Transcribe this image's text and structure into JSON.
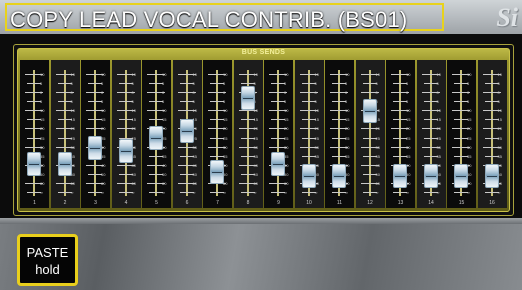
{
  "title": "COPY LEAD VOCAL CONTRIB. (BS01)",
  "logo": "Si",
  "bus_sends_label": "BUS SENDS",
  "scale_labels": [
    "10",
    "5",
    "0",
    "5",
    "10",
    "15",
    "20",
    "25",
    "30",
    "35",
    "40",
    "50",
    "60",
    "∞"
  ],
  "channels": [
    {
      "label": "1",
      "level": 0.2
    },
    {
      "label": "2",
      "level": 0.2
    },
    {
      "label": "3",
      "level": 0.35
    },
    {
      "label": "4",
      "level": 0.32
    },
    {
      "label": "5",
      "level": 0.45
    },
    {
      "label": "6",
      "level": 0.52
    },
    {
      "label": "7",
      "level": 0.12
    },
    {
      "label": "8",
      "level": 0.84
    },
    {
      "label": "9",
      "level": 0.2
    },
    {
      "label": "10",
      "level": 0.08
    },
    {
      "label": "11",
      "level": 0.08
    },
    {
      "label": "12",
      "level": 0.72
    },
    {
      "label": "13",
      "level": 0.08
    },
    {
      "label": "14",
      "level": 0.08
    },
    {
      "label": "15",
      "level": 0.08
    },
    {
      "label": "16",
      "level": 0.08
    }
  ],
  "paste_button": {
    "line1": "PASTE",
    "line2": "hold"
  },
  "colors": {
    "accent": "#e9cf1c",
    "panel_border": "#c9c247"
  }
}
